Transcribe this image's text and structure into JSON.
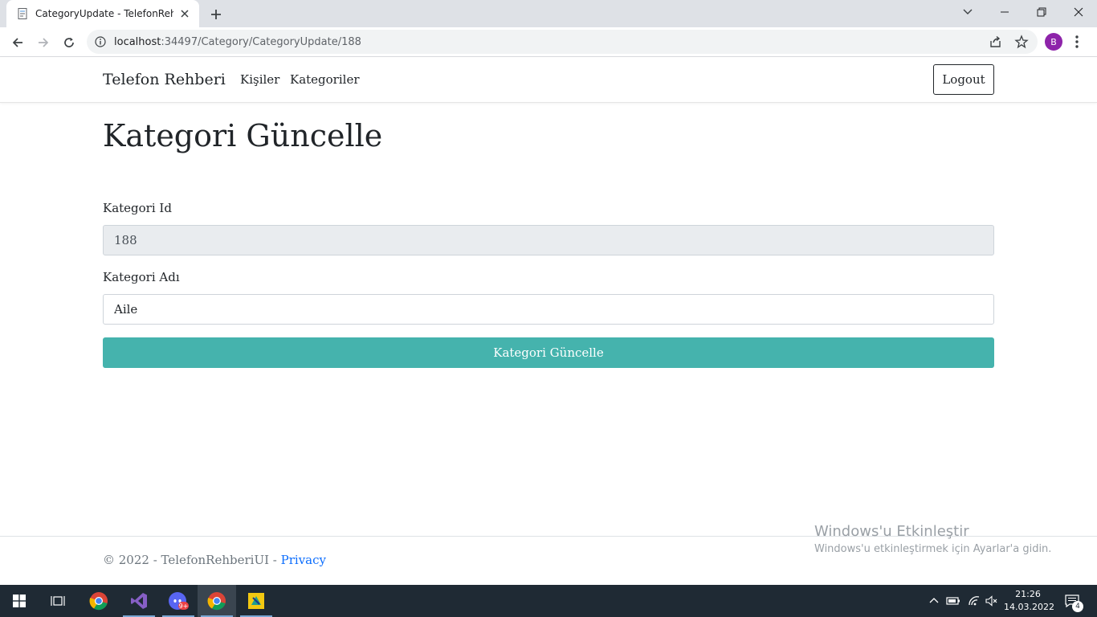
{
  "browser": {
    "tab_title": "CategoryUpdate - TelefonRehberiUI",
    "url_host": "localhost",
    "url_rest": ":34497/Category/CategoryUpdate/188",
    "profile_initial": "B"
  },
  "navbar": {
    "brand": "Telefon Rehberi",
    "links": [
      "Kişiler",
      "Kategoriler"
    ],
    "logout_label": "Logout"
  },
  "form": {
    "heading": "Kategori Güncelle",
    "id_label": "Kategori Id",
    "id_value": "188",
    "name_label": "Kategori Adı",
    "name_value": "Aile",
    "submit_label": "Kategori Güncelle"
  },
  "footer": {
    "copyright": "© 2022 - TelefonRehberiUI - ",
    "privacy": "Privacy"
  },
  "watermark": {
    "title": "Windows'u Etkinleştir",
    "subtitle": "Windows'u etkinleştirmek için Ayarlar'a gidin."
  },
  "taskbar": {
    "time": "21:26",
    "date": "14.03.2022",
    "notification_count": "4",
    "discord_badge": "9+"
  },
  "colors": {
    "accent_button": "#45b3ad",
    "link": "#0d6efd",
    "taskbar": "#1f2a34"
  }
}
